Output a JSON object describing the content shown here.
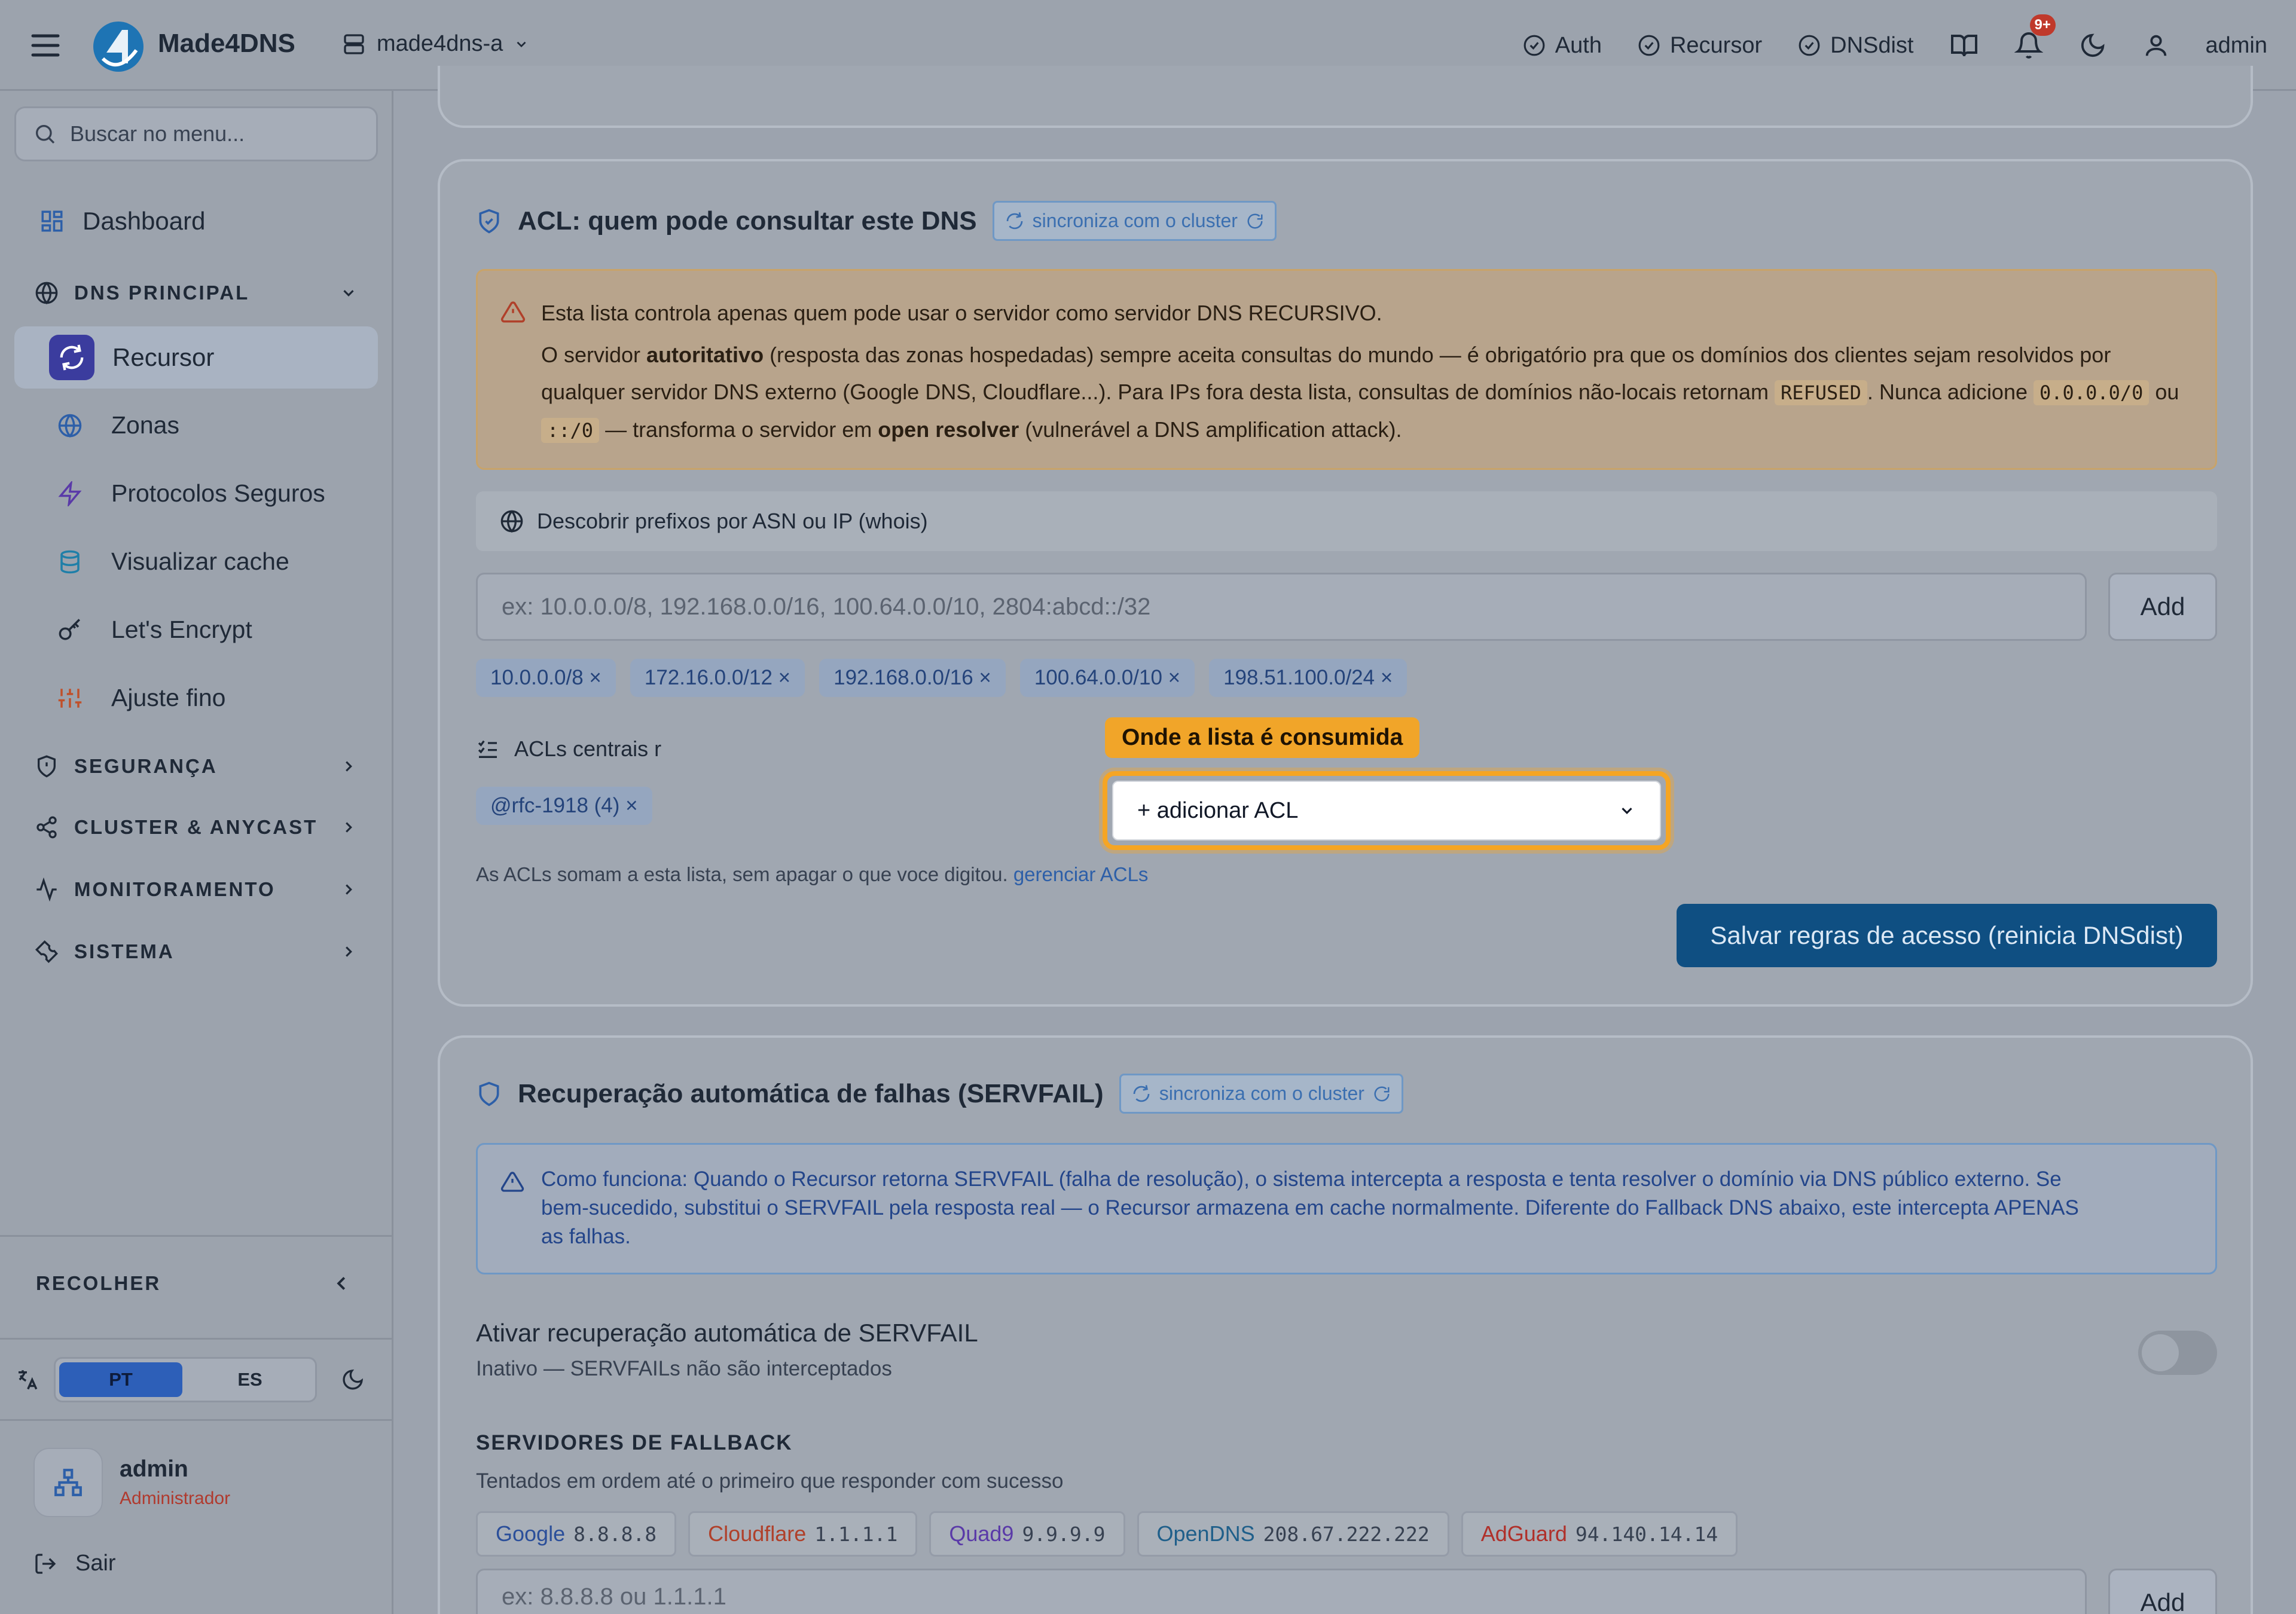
{
  "header": {
    "brand": "Made4DNS",
    "server": "made4dns-a",
    "statuses": [
      "Auth",
      "Recursor",
      "DNSdist"
    ],
    "notifications_badge": "9+",
    "user": "admin"
  },
  "sidebar": {
    "search_placeholder": "Buscar no menu...",
    "dashboard": "Dashboard",
    "sections": {
      "dns_principal": "DNS PRINCIPAL",
      "seguranca": "SEGURANÇA",
      "cluster": "CLUSTER & ANYCAST",
      "monitoramento": "MONITORAMENTO",
      "sistema": "SISTEMA"
    },
    "items": {
      "recursor": "Recursor",
      "zonas": "Zonas",
      "protocolos": "Protocolos Seguros",
      "cache": "Visualizar cache",
      "letsencrypt": "Let's Encrypt",
      "ajuste": "Ajuste fino"
    },
    "collapse": "RECOLHER",
    "lang": {
      "pt": "PT",
      "es": "ES"
    },
    "user": {
      "name": "admin",
      "role": "Administrador"
    },
    "logout": "Sair"
  },
  "acl_card": {
    "title": "ACL: quem pode consultar este DNS",
    "sync": "sincroniza com o cluster",
    "warning": {
      "line1": "Esta lista controla apenas quem pode usar o servidor como servidor DNS RECURSIVO.",
      "p_a": "O servidor ",
      "p_b": "autoritativo",
      "p_c": " (resposta das zonas hospedadas) sempre aceita consultas do mundo — é obrigatório pra que os domínios dos clientes sejam resolvidos",
      "p_d": "por qualquer servidor DNS externo (Google DNS, Cloudflare...). Para IPs fora desta lista, consultas de domínios não-locais retornam ",
      "p_code1": "REFUSED",
      "p_e": ". Nunca adicione",
      "p_code2": "0.0.0.0/0",
      "p_f": " ou ",
      "p_code3": "::/0",
      "p_g": " — transforma o servidor em ",
      "p_h": "open resolver",
      "p_i": " (vulnerável a DNS amplification attack)."
    },
    "discover": "Descobrir prefixos por ASN ou IP (whois)",
    "input_placeholder": "ex: 10.0.0.0/8, 192.168.0.0/16, 100.64.0.0/10, 2804:abcd::/32",
    "add_label": "Add",
    "chips": [
      "10.0.0.0/8 ×",
      "172.16.0.0/12 ×",
      "192.168.0.0/16 ×",
      "100.64.0.0/10 ×",
      "198.51.100.0/24 ×"
    ],
    "acl_central_label": "ACLs centrais r",
    "tooltip": "Onde a lista é consumida",
    "acl_chip": "@rfc-1918 (4) ×",
    "select_value": "+ adicionar ACL",
    "help_text": "As ACLs somam a esta lista, sem apagar o que voce digitou. ",
    "help_link": "gerenciar ACLs",
    "save_label": "Salvar regras de acesso (reinicia DNSdist)"
  },
  "servfail_card": {
    "title": "Recuperação automática de falhas (SERVFAIL)",
    "sync": "sincroniza com o cluster",
    "info": {
      "l1": "Como funciona: Quando o Recursor retorna SERVFAIL (falha de resolução), o sistema intercepta a resposta e tenta resolver o domínio via DNS público externo. Se",
      "l2": "bem-sucedido, substitui o SERVFAIL pela resposta real — o Recursor armazena em cache normalmente. Diferente do Fallback DNS abaixo, este intercepta APENAS",
      "l3": "as falhas."
    },
    "toggle_label": "Ativar recuperação automática de SERVFAIL",
    "toggle_sub": "Inativo — SERVFAILs não são interceptados",
    "fallback_title": "SERVIDORES DE FALLBACK",
    "fallback_sub": "Tentados em ordem até o primeiro que responder com sucesso",
    "servers": [
      {
        "name": "Google",
        "ip": "8.8.8.8",
        "color": "#2b4f9a"
      },
      {
        "name": "Cloudflare",
        "ip": "1.1.1.1",
        "color": "#b0402a"
      },
      {
        "name": "Quad9",
        "ip": "9.9.9.9",
        "color": "#5a3aa8"
      },
      {
        "name": "OpenDNS",
        "ip": "208.67.222.222",
        "color": "#1f5f8a"
      },
      {
        "name": "AdGuard",
        "ip": "94.140.14.14",
        "color": "#b0302a"
      }
    ],
    "input_placeholder": "ex: 8.8.8.8 ou 1.1.1.1",
    "add_label": "Add"
  }
}
